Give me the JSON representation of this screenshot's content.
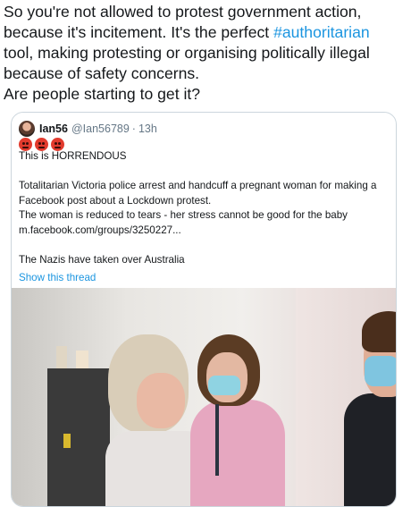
{
  "tweet": {
    "lines": [
      "So you're not allowed to protest government action,",
      "because it's incitement.  It's the perfect ",
      "tool, making protesting or organising politically illegal",
      "because of safety concerns.",
      "Are people starting to get it?"
    ],
    "hashtag": "#authoritarian"
  },
  "quoted": {
    "name": "Ian56",
    "handle": "@Ian56789",
    "separator": "·",
    "time": "13h",
    "emojis": [
      "angry-face-icon",
      "angry-face-icon",
      "angry-face-icon"
    ],
    "body": [
      "This is HORRENDOUS",
      "",
      "Totalitarian Victoria police arrest and handcuff a pregnant woman for making a",
      "Facebook post about a Lockdown protest.",
      "The woman is reduced to tears - her stress cannot be good for the baby",
      "m.facebook.com/groups/3250227...",
      "",
      "The Nazis have taken over Australia"
    ],
    "show_thread": "Show this thread"
  },
  "colors": {
    "link": "#1b95e0",
    "border": "#ccd6dd",
    "meta": "#657786"
  }
}
